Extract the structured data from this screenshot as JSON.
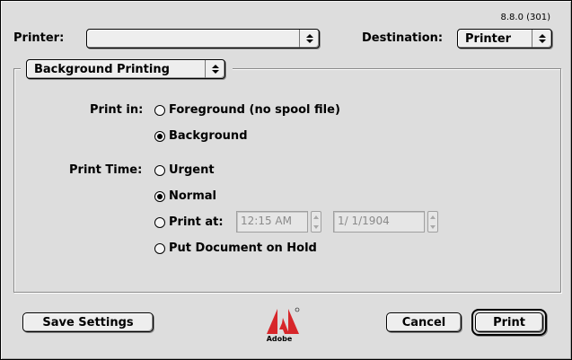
{
  "version": "8.8.0 (301)",
  "printer": {
    "label": "Printer:",
    "value": ""
  },
  "destination": {
    "label": "Destination:",
    "value": "Printer"
  },
  "panel_menu": {
    "value": "Background Printing"
  },
  "print_in": {
    "label": "Print in:",
    "options": [
      {
        "label": "Foreground (no spool file)",
        "selected": false
      },
      {
        "label": "Background",
        "selected": true
      }
    ]
  },
  "print_time": {
    "label": "Print Time:",
    "options": [
      {
        "label": "Urgent",
        "selected": false
      },
      {
        "label": "Normal",
        "selected": true
      },
      {
        "label": "Print at:",
        "selected": false
      },
      {
        "label": "Put Document on Hold",
        "selected": false
      }
    ],
    "time_value": "12:15 AM",
    "date_value": "1/ 1/1904"
  },
  "buttons": {
    "save_settings": "Save Settings",
    "cancel": "Cancel",
    "print": "Print"
  },
  "logo": {
    "text": "Adobe",
    "color": "#d7262a",
    "icon": "adobe-logo-icon"
  }
}
